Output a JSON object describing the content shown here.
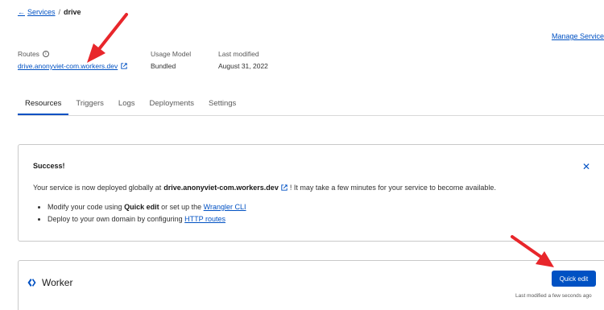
{
  "breadcrumb": {
    "back_link": "Services",
    "separator": "/",
    "current": "drive"
  },
  "header": {
    "manage_link": "Manage Service"
  },
  "meta": {
    "routes_label": "Routes",
    "routes_value": "drive.anonyviet-com.workers.dev",
    "usage_model_label": "Usage Model",
    "usage_model_value": "Bundled",
    "last_modified_label": "Last modified",
    "last_modified_value": "August 31, 2022"
  },
  "tabs": [
    {
      "label": "Resources",
      "active": true
    },
    {
      "label": "Triggers"
    },
    {
      "label": "Logs"
    },
    {
      "label": "Deployments"
    },
    {
      "label": "Settings"
    }
  ],
  "success": {
    "title": "Success!",
    "msg_pre": "Your service is now deployed globally at",
    "msg_domain": "drive.anonyviet-com.workers.dev",
    "msg_post": "! It may take a few minutes for your service to become available.",
    "bullet1_pre": "Modify your code using",
    "bullet1_bold": "Quick edit",
    "bullet1_mid": "or set up the",
    "bullet1_link": "Wrangler CLI",
    "bullet2_pre": "Deploy to your own domain by configuring",
    "bullet2_link": "HTTP routes"
  },
  "worker": {
    "title": "Worker",
    "quick_edit_label": "Quick edit",
    "last_modified": "Last modified a few seconds ago"
  },
  "colors": {
    "accent": "#0051c3",
    "annotation_arrow": "#e8262b"
  }
}
